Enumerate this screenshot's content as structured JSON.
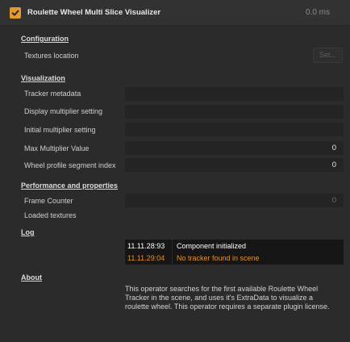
{
  "header": {
    "title": "Roulette Wheel Multi Slice Visualizer",
    "timing": "0.0 ms",
    "enabled": true,
    "accent_color": "#e59a2c"
  },
  "configuration": {
    "heading": "Configuration",
    "textures_label": "Textures location",
    "set_label": "Set..."
  },
  "visualization": {
    "heading": "Visualization",
    "rows": [
      {
        "label": "Tracker metadata",
        "value": ""
      },
      {
        "label": "Display multiplier setting",
        "value": ""
      },
      {
        "label": "Initial multiplier setting",
        "value": ""
      },
      {
        "label": "Max Multiplier Value",
        "value": "0"
      },
      {
        "label": "Wheel profile segment index",
        "value": "0"
      }
    ]
  },
  "performance": {
    "heading": "Performance and properties",
    "frame_counter_label": "Frame Counter",
    "frame_counter_value": "0",
    "loaded_textures_label": "Loaded textures"
  },
  "log": {
    "heading": "Log",
    "entries": [
      {
        "time": "11.11.28:93",
        "message": "Component initialized",
        "color": "#ffffff"
      },
      {
        "time": "11.11.29:04",
        "message": "No tracker found in scene",
        "color": "#e3922c"
      }
    ]
  },
  "about": {
    "heading": "About",
    "text": "This operator searches for the first available Roulette Wheel Tracker in the scene, and uses it's ExtraData to visualize a roulette wheel. This operator requires a separate plugin license."
  }
}
